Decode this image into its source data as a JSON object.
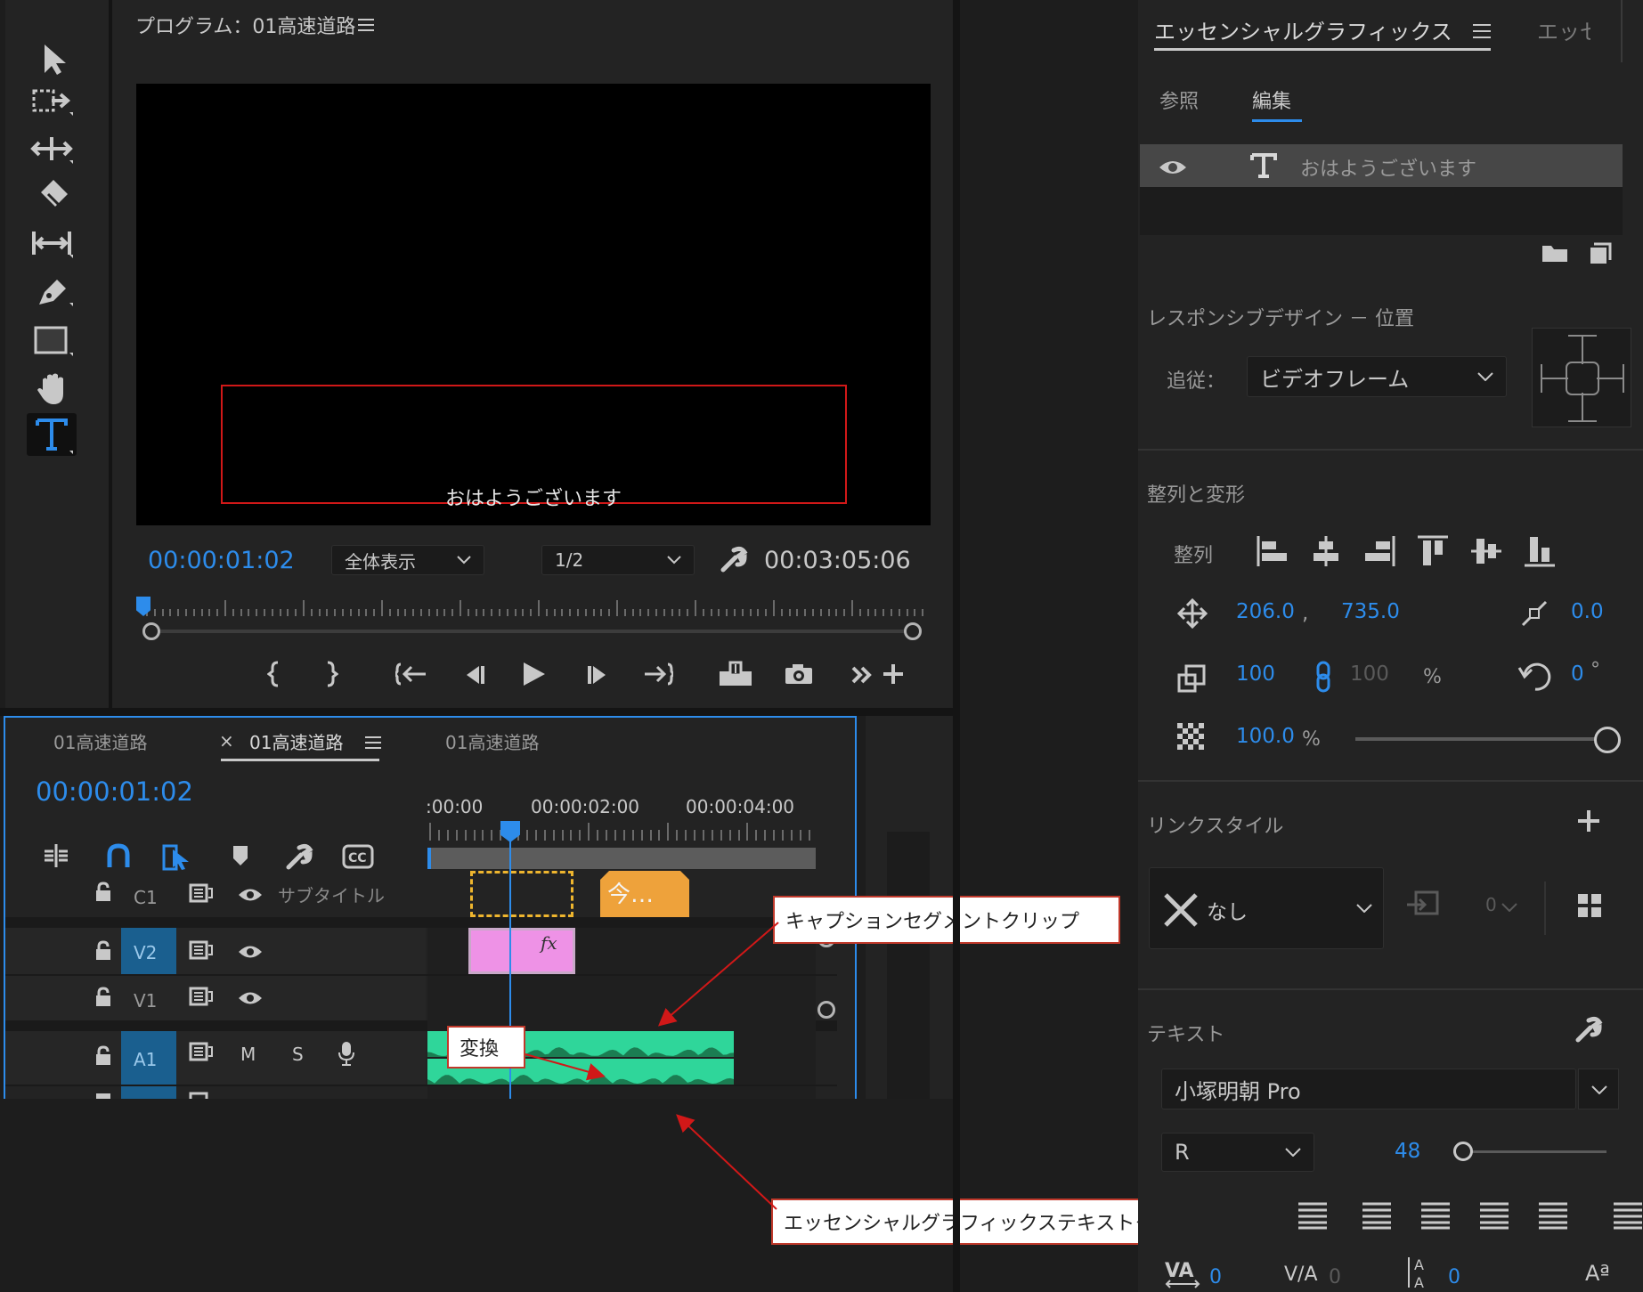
{
  "program_monitor": {
    "title": "プログラム：01高速道路",
    "overlay_text": "おはようございます",
    "current_time": "00:00:01:02",
    "fit_label": "全体表示",
    "resolution_label": "1/2",
    "duration": "00:03:05:06"
  },
  "timeline": {
    "tabs": [
      "01高速道路",
      "01高速道路",
      "01高速道路"
    ],
    "close_symbol": "×",
    "current_time": "00:00:01:02",
    "ruler_labels": [
      ":00:00",
      "00:00:02:00",
      "00:00:04:00"
    ],
    "tracks": {
      "c1": {
        "label": "C1",
        "name": "サブタイトル"
      },
      "v2": {
        "label": "V2"
      },
      "v1": {
        "label": "V1"
      },
      "a1": {
        "label": "A1",
        "m": "M",
        "s": "S"
      }
    },
    "caption_clip_text": "今…",
    "fx_label": "fx"
  },
  "callouts": {
    "caption_segment": "キャプションセグメントクリップ",
    "transform": "変換",
    "eg_text_clip": "エッセンシャルグラフィックステキストクリップ"
  },
  "essential_graphics": {
    "title": "エッセンシャルグラフィックス",
    "second_tab": "エッセ",
    "sub_tabs": [
      "参照",
      "編集"
    ],
    "layer_name": "おはようございます",
    "responsive_heading": "レスポンシブデザイン － 位置",
    "follow_label": "追従：",
    "follow_value": "ビデオフレーム",
    "align_heading": "整列と変形",
    "align_label": "整列",
    "position_x": "206.0",
    "position_y": "735.0",
    "comma": ",",
    "anchor_value": "0.0",
    "scale": "100",
    "scale_linked": "100",
    "percent": "%",
    "rotation": "0",
    "degree": "°",
    "opacity": "100.0",
    "link_style_heading": "リンクスタイル",
    "style_value": "なし",
    "style_count": "0",
    "text_heading": "テキスト",
    "font_name": "小塚明朝 Pro",
    "font_style": "R",
    "font_size": "48",
    "kerning": "0",
    "tracking": "0",
    "leading": "0"
  },
  "colors": {
    "accent_blue": "#2d8ceb",
    "clip_pink": "#ee92e6",
    "clip_orange": "#eea23b",
    "audio_green": "#2fd69a",
    "callout_border": "#c0392b",
    "selection_red": "#d11818"
  }
}
